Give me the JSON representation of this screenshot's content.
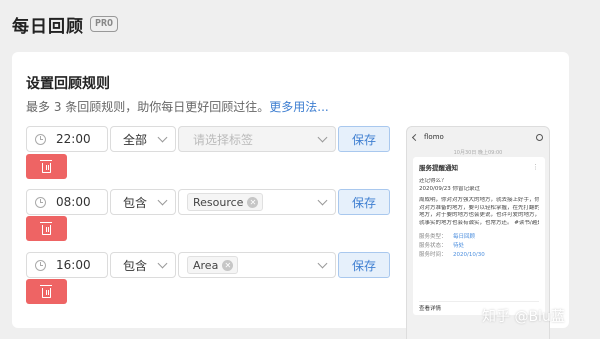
{
  "header": {
    "title": "每日回顾",
    "badge": "PRO"
  },
  "section": {
    "title": "设置回顾规则",
    "description": "最多 3 条回顾规则，助你每日更好回顾过往。",
    "more_link": "更多用法..."
  },
  "rules": [
    {
      "time": "22:00",
      "mode": "全部",
      "tag_placeholder": "请选择标签",
      "tag": "",
      "save_label": "保存"
    },
    {
      "time": "08:00",
      "mode": "包含",
      "tag_placeholder": "",
      "tag": "Resource",
      "save_label": "保存"
    },
    {
      "time": "16:00",
      "mode": "包含",
      "tag_placeholder": "",
      "tag": "Area",
      "save_label": "保存"
    }
  ],
  "preview": {
    "app_name": "flomo",
    "timestamp": "10月30日 晚上09:00",
    "card_title": "服务提醒通知",
    "lines": [
      "还记得么？",
      "2020/09/23 你曾记录过",
      "周成明，你对对方强大的地方，就去接上好手，你",
      "对对方准备的地方，要可以轻松掌握，在先打翻的",
      "地方，对于要的地方也会更说，也许可爱的地方，",
      "就事实的地方也会有诚实，也常方还。 #读书/越是有读"
    ],
    "meta": [
      {
        "k": "服务类型：",
        "v": "每日回顾"
      },
      {
        "k": "服务状态：",
        "v": "待处"
      },
      {
        "k": "服务时间：",
        "v": "2020/10/30"
      }
    ],
    "footer": "查看详情"
  },
  "watermark": "知乎 @Blu蓝"
}
